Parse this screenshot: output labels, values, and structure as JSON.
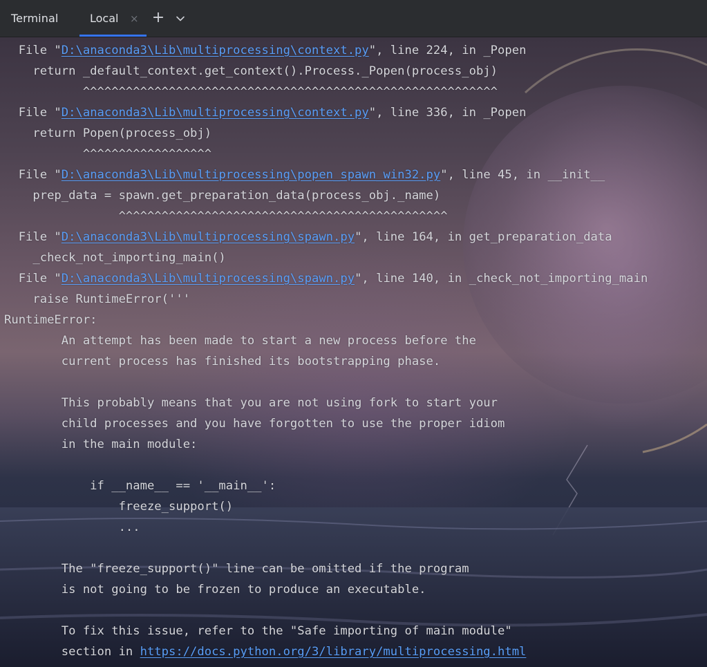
{
  "tabbar": {
    "title": "Terminal",
    "tabs": [
      {
        "label": "Local",
        "close_glyph": "×",
        "active": true
      }
    ],
    "add_glyph": "+",
    "icons": {
      "close": "close-icon",
      "add": "plus-icon",
      "dropdown": "chevron-down-icon"
    }
  },
  "colors": {
    "tabbar_bg": "#2b2d30",
    "text": "#d5d6db",
    "link": "#589df6",
    "tab_accent": "#3574f0"
  },
  "terminal": {
    "lines": [
      {
        "indent": "  ",
        "pre": "File \"",
        "link": "D:\\anaconda3\\Lib\\multiprocessing\\context.py",
        "post": "\", line 224, in _Popen"
      },
      {
        "text": "    return _default_context.get_context().Process._Popen(process_obj)"
      },
      {
        "text": "           ^^^^^^^^^^^^^^^^^^^^^^^^^^^^^^^^^^^^^^^^^^^^^^^^^^^^^^^^^^"
      },
      {
        "indent": "  ",
        "pre": "File \"",
        "link": "D:\\anaconda3\\Lib\\multiprocessing\\context.py",
        "post": "\", line 336, in _Popen"
      },
      {
        "text": "    return Popen(process_obj)"
      },
      {
        "text": "           ^^^^^^^^^^^^^^^^^^"
      },
      {
        "indent": "  ",
        "pre": "File \"",
        "link": "D:\\anaconda3\\Lib\\multiprocessing\\popen_spawn_win32.py",
        "post": "\", line 45, in __init__"
      },
      {
        "text": "    prep_data = spawn.get_preparation_data(process_obj._name)"
      },
      {
        "text": "                ^^^^^^^^^^^^^^^^^^^^^^^^^^^^^^^^^^^^^^^^^^^^^^"
      },
      {
        "indent": "  ",
        "pre": "File \"",
        "link": "D:\\anaconda3\\Lib\\multiprocessing\\spawn.py",
        "post": "\", line 164, in get_preparation_data"
      },
      {
        "text": "    _check_not_importing_main()"
      },
      {
        "indent": "  ",
        "pre": "File \"",
        "link": "D:\\anaconda3\\Lib\\multiprocessing\\spawn.py",
        "post": "\", line 140, in _check_not_importing_main"
      },
      {
        "text": "    raise RuntimeError('''"
      },
      {
        "text": "RuntimeError:"
      },
      {
        "text": "        An attempt has been made to start a new process before the"
      },
      {
        "text": "        current process has finished its bootstrapping phase."
      },
      {
        "text": ""
      },
      {
        "text": "        This probably means that you are not using fork to start your"
      },
      {
        "text": "        child processes and you have forgotten to use the proper idiom"
      },
      {
        "text": "        in the main module:"
      },
      {
        "text": ""
      },
      {
        "text": "            if __name__ == '__main__':"
      },
      {
        "text": "                freeze_support()"
      },
      {
        "text": "                ..."
      },
      {
        "text": ""
      },
      {
        "text": "        The \"freeze_support()\" line can be omitted if the program"
      },
      {
        "text": "        is not going to be frozen to produce an executable."
      },
      {
        "text": ""
      },
      {
        "text": "        To fix this issue, refer to the \"Safe importing of main module\""
      },
      {
        "indent": "        ",
        "pre": "section in ",
        "link": "https://docs.python.org/3/library/multiprocessing.html",
        "post": ""
      }
    ]
  }
}
